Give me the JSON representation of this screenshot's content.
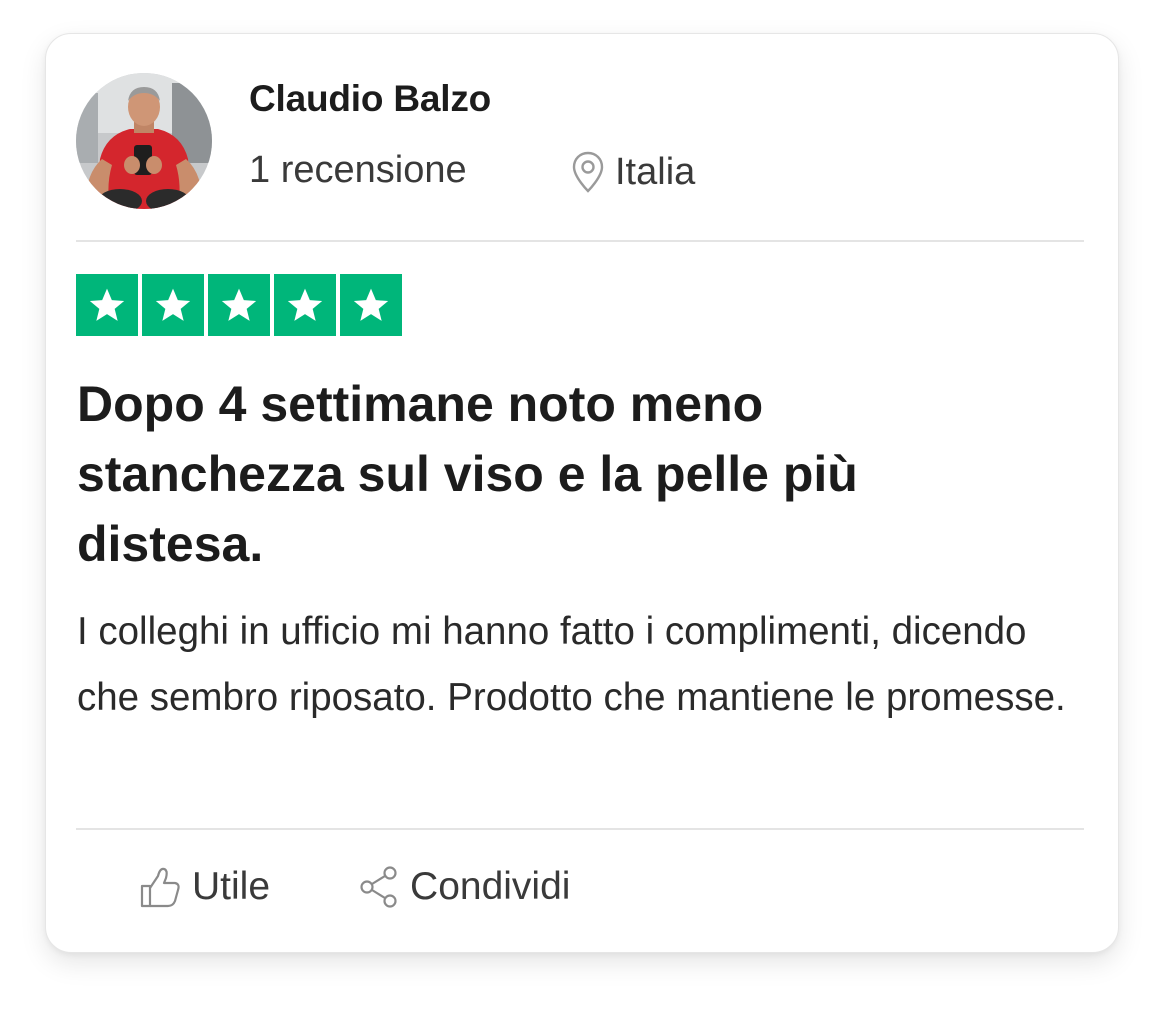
{
  "reviewer": {
    "name": "Claudio Balzo",
    "review_count": "1 recensione",
    "location": "Italia",
    "avatar_icon": "reviewer-photo"
  },
  "rating": {
    "stars": 5,
    "max": 5,
    "color": "#00b67a"
  },
  "review": {
    "title": "Dopo 4 settimane noto meno stanchezza sul viso e la pelle più distesa.",
    "body": "I colleghi in ufficio mi hanno fatto i complimenti, dicendo che sembro riposato. Prodotto che mantiene le promesse."
  },
  "actions": {
    "helpful_label": "Utile",
    "helpful_icon": "thumbs-up-icon",
    "share_label": "Condividi",
    "share_icon": "share-icon"
  },
  "icons": {
    "location": "map-pin-icon",
    "star": "star-icon"
  }
}
